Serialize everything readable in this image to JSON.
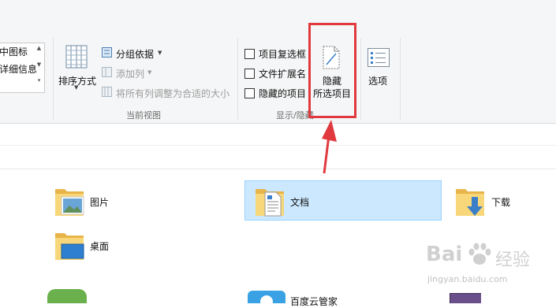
{
  "layout_group": {
    "gallery_items": [
      "中图标",
      "详细信息"
    ]
  },
  "current_view": {
    "label": "当前视图",
    "sort_by": "排序方式",
    "group_by": "分组依据",
    "add_column": "添加列",
    "fit_columns": "将所有列调整为合适的大小"
  },
  "show_hide": {
    "label": "显示/隐藏",
    "checkboxes": [
      {
        "label": "项目复选框",
        "checked": false
      },
      {
        "label": "文件扩展名",
        "checked": false
      },
      {
        "label": "隐藏的项目",
        "checked": false
      }
    ],
    "hide_selected_line1": "隐藏",
    "hide_selected_line2": "所选项目"
  },
  "options": {
    "label": "选项"
  },
  "folders": [
    {
      "name": "图片",
      "icon": "pictures-folder-icon"
    },
    {
      "name": "文档",
      "icon": "documents-folder-icon",
      "selected": true
    },
    {
      "name": "下载",
      "icon": "downloads-folder-icon"
    },
    {
      "name": "桌面",
      "icon": "desktop-folder-icon"
    }
  ],
  "bottom_items": [
    {
      "name": "百度云管家",
      "icon": "baidu-cloud-icon"
    }
  ],
  "watermark": {
    "brand_left": "Bai",
    "brand_right": "经验",
    "url": "jingyan.baidu.com"
  },
  "colors": {
    "highlight": "#e0393e",
    "selection": "#cce8ff",
    "ribbon": "#f5f6f7"
  }
}
